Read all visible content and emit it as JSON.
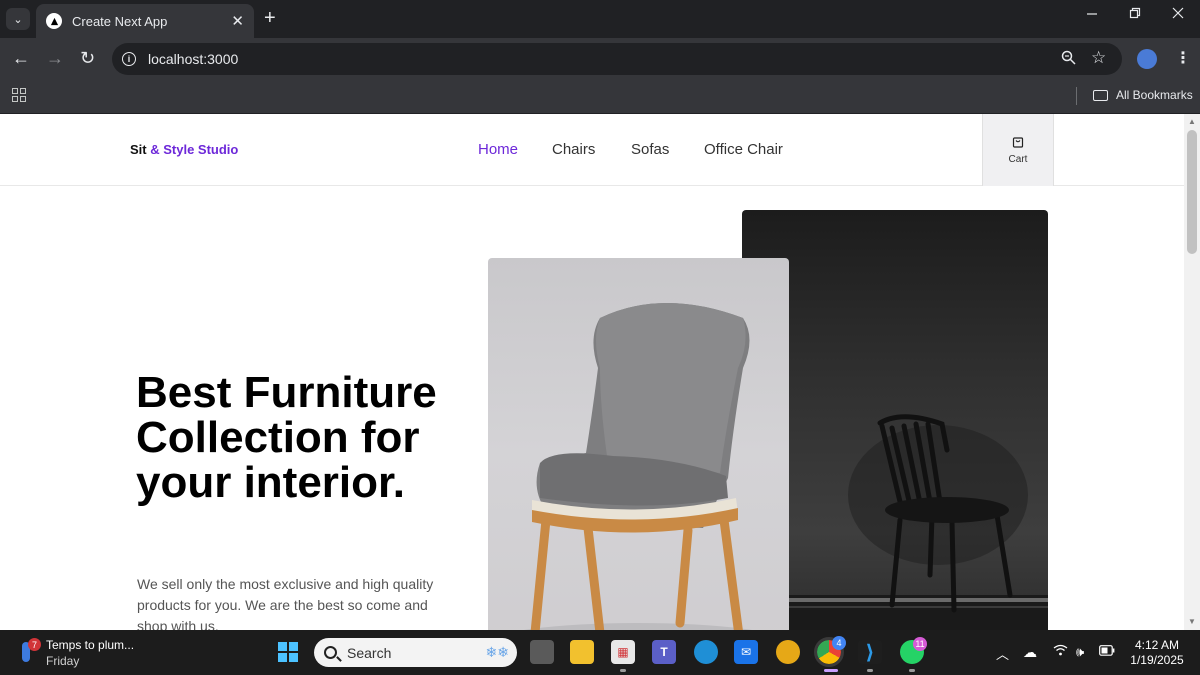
{
  "browser": {
    "tab_title": "Create Next App",
    "tab_close": "✕",
    "new_tab": "+",
    "url": "localhost:3000",
    "bookmarks_label": "All Bookmarks"
  },
  "site": {
    "brand_main": "Sit",
    "brand_accent": " & Style Studio",
    "nav": [
      "Home",
      "Chairs",
      "Sofas",
      "Office Chair"
    ],
    "cart_label": "Cart",
    "hero_title": "Best Furniture Collection for your interior.",
    "hero_desc": "We sell only the most exclusive and high quality products for you. We are the best so come and shop with us."
  },
  "taskbar": {
    "weather_title": "Temps to plum...",
    "weather_sub": "Friday",
    "weather_badge": "7",
    "search_placeholder": "Search",
    "whatsapp_badge": "11",
    "chrome_badge": "4",
    "time": "4:12 AM",
    "date": "1/19/2025"
  },
  "colors": {
    "accent": "#6d28d9",
    "chrome_dark": "#202124",
    "chrome_mid": "#35363a",
    "taskbar": "#1c1c1c"
  }
}
